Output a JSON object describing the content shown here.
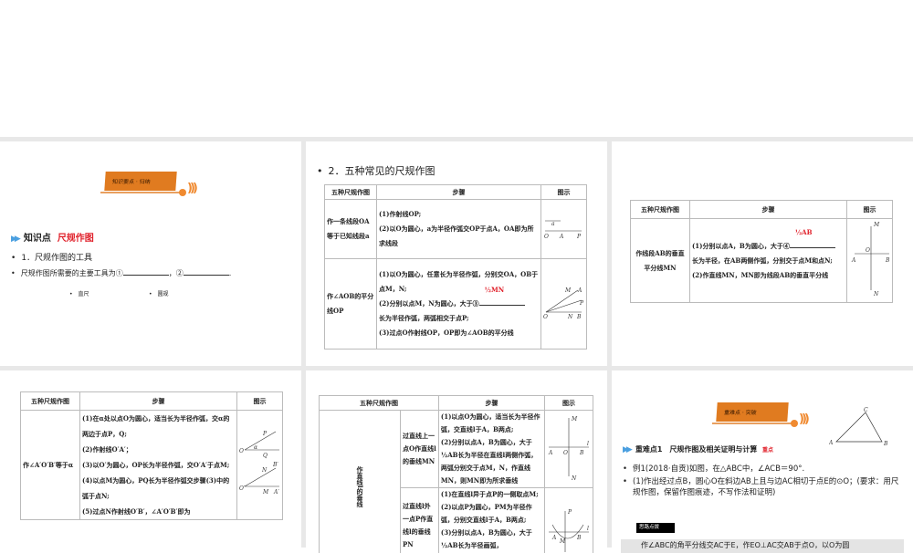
{
  "slide1": {
    "banner": "知识要点 · 归纳",
    "heading_prefix": "知识点",
    "heading_topic": "尺规作图",
    "bullet1": "1．尺规作图的工具",
    "bullet2_a": "尺规作图所需要的主要工具为①",
    "bullet2_b": "，②",
    "bullet2_c": ".",
    "answer1": "直尺",
    "answer2": "圆规"
  },
  "slide2": {
    "title": "2．五种常见的尺规作图",
    "headers": [
      "五种尺规作图",
      "步骤",
      "图示"
    ],
    "row1": {
      "name": "作一条线段OA等于已知线段a",
      "steps": [
        "(1)作射线OP;",
        "(2)以O为圆心，a为半径作弧交OP于点A，OA即为所求线段"
      ],
      "labels": [
        "a",
        "O",
        "A",
        "P"
      ]
    },
    "row2": {
      "name": "作∠AOB的平分线OP",
      "steps": [
        "(1)以O为圆心，任意长为半径作弧，分别交OA，OB于点M，N;",
        "(2)分别以点M，N为圆心，大于③",
        "长为半径作弧，两弧相交于点P;",
        "(3)过点O作射线OP，OP即为∠AOB的平分线"
      ],
      "answer": "½MN",
      "labels": [
        "M",
        "A",
        "P",
        "O",
        "N",
        "B"
      ]
    }
  },
  "slide3": {
    "headers": [
      "五种尺规作图",
      "步骤",
      "图示"
    ],
    "name": "作线段AB的垂直平分线MN",
    "steps": [
      "(1)分别以点A，B为圆心，大于④",
      "长为半径，在AB两侧作弧，分别交于点M和点N;",
      "(2)作直线MN，MN即为线段AB的垂直平分线"
    ],
    "answer": "½AB",
    "labels": [
      "M",
      "O",
      "A",
      "B",
      "N"
    ]
  },
  "slide4": {
    "headers": [
      "五种尺规作图",
      "步骤",
      "图示"
    ],
    "name": "作∠A′O′B′等于α",
    "steps": [
      "(1)在α处以点O为圆心，适当长为半径作弧，交α的两边于点P，Q;",
      "(2)作射线O′A′；",
      "(3)以O′为圆心，OP长为半径作弧，交O′A′于点M;",
      "(4)以点M为圆心，PQ长为半径作弧交步骤(3)中的弧于点N;",
      "(5)过点N作射线O′B′，∠A′O′B′即为"
    ],
    "labels": [
      "P",
      "O",
      "α",
      "Q",
      "N",
      "B′",
      "O′",
      "M",
      "A′"
    ]
  },
  "slide5": {
    "headers": [
      "五种尺规作图",
      "步骤",
      "图示"
    ],
    "group": "作直线l的垂线",
    "row1": {
      "name": "过直线上一点O作直线l的垂线MN",
      "steps": [
        "(1)以点O为圆心，适当长为半径作弧，交直线l于A，B两点;",
        "(2)分别以点A，B为圆心，大于½AB长为半径在直线l两侧作弧，两弧分别交于点M，N，作直线MN，则MN即为所求垂线"
      ],
      "labels": [
        "M",
        "A",
        "O",
        "B",
        "l",
        "N"
      ]
    },
    "row2": {
      "name": "过直线l外一点P作直线l的垂线PN",
      "steps": [
        "(1)在直线l异于点P的一侧取点M;",
        "(2)以点P为圆心，PM为半径作弧，分别交直线l于A，B两点;",
        "(3)分别以点A，B为圆心，大于½AB长为半径画弧，"
      ],
      "labels": [
        "P",
        "A",
        "M",
        "B",
        "l"
      ]
    }
  },
  "slide6": {
    "banner": "重难点 · 突破",
    "heading": "重难点1　尺规作图及相关证明与计算",
    "tag": "重点",
    "example": "例1(2018·自贡)如图，在△ABC中，∠ACB＝90°.",
    "q1": "(1)作出经过点B，圆心O在斜边AB上且与边AC相切于点E的⊙O；(要求：用尺规作图，保留作图痕迹，不写作法和证明)",
    "hint_label": "思路点拨",
    "hint_text": "作∠ABC的角平分线交AC于E，作EO⊥AC交AB于点O，以O为圆",
    "labels": [
      "C",
      "A",
      "B"
    ]
  },
  "colors": {
    "accent": "#e07b20",
    "red": "#e0202a",
    "arrow": "#4a9fe0"
  }
}
